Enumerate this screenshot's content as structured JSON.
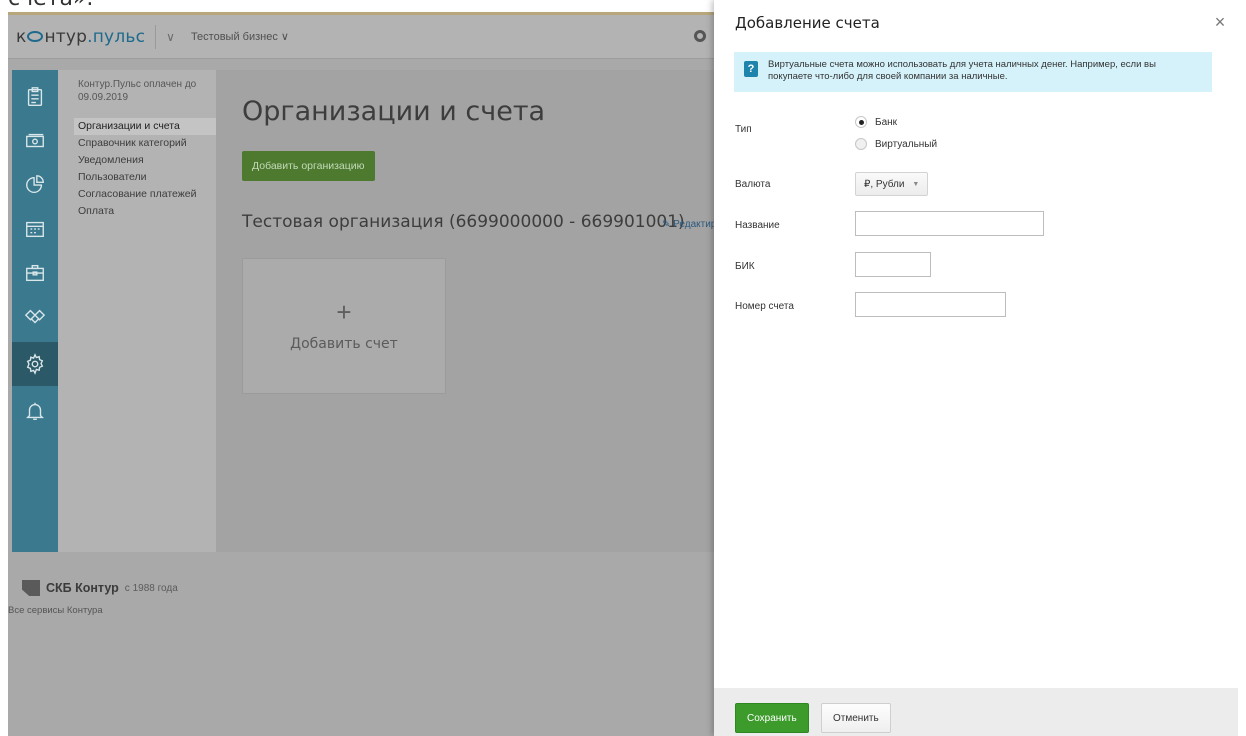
{
  "top_fragment": "счета».",
  "app": {
    "logo": {
      "prefix": "к",
      "middle": "нтур",
      "accent": ".пульс"
    },
    "business_label": "Тестовый бизнес ∨",
    "product_chevron": "∨",
    "submenu": {
      "paid_note": "Контур.Пульс оплачен до 09.09.2019",
      "items": [
        "Организации и счета",
        "Справочник категорий",
        "Уведомления",
        "Пользователи",
        "Согласование платежей",
        "Оплата"
      ],
      "active_index": 0
    },
    "rail_icons": [
      "clipboard-icon",
      "money-icon",
      "chart-icon",
      "calendar-icon",
      "briefcase-icon",
      "handshake-icon",
      "settings-icon",
      "bell-icon"
    ],
    "content": {
      "page_title": "Организации и счета",
      "add_org_button": "Добавить организацию",
      "org_title": "Тестовая организация (6699000000 - 669901001)",
      "edit_link": "✎ Редактир",
      "add_card_plus": "+",
      "add_card_label": "Добавить счет"
    },
    "footer": {
      "brand": "СКБ Контур",
      "since": "с 1988 года",
      "all_services": "Все сервисы Контура"
    }
  },
  "panel": {
    "title": "Добавление счета",
    "close_glyph": "×",
    "info_icon": "?",
    "info_text": "Виртуальные счета можно использовать для учета наличных денег. Например, если вы покупаете что-либо для своей компании за наличные.",
    "type_label": "Тип",
    "type_options": [
      "Банк",
      "Виртуальный"
    ],
    "type_selected": "Банк",
    "currency_label": "Валюта",
    "currency_value": "₽, Рубли",
    "name_label": "Название",
    "name_value": "",
    "bik_label": "БИК",
    "bik_value": "",
    "account_label": "Номер счета",
    "account_value": "",
    "save_button": "Сохранить",
    "cancel_button": "Отменить"
  },
  "colors": {
    "rail": "#3b7a8e",
    "save_green": "#3c9b2b",
    "info_bg": "#d5f2fa",
    "info_icon": "#1e84ab"
  }
}
